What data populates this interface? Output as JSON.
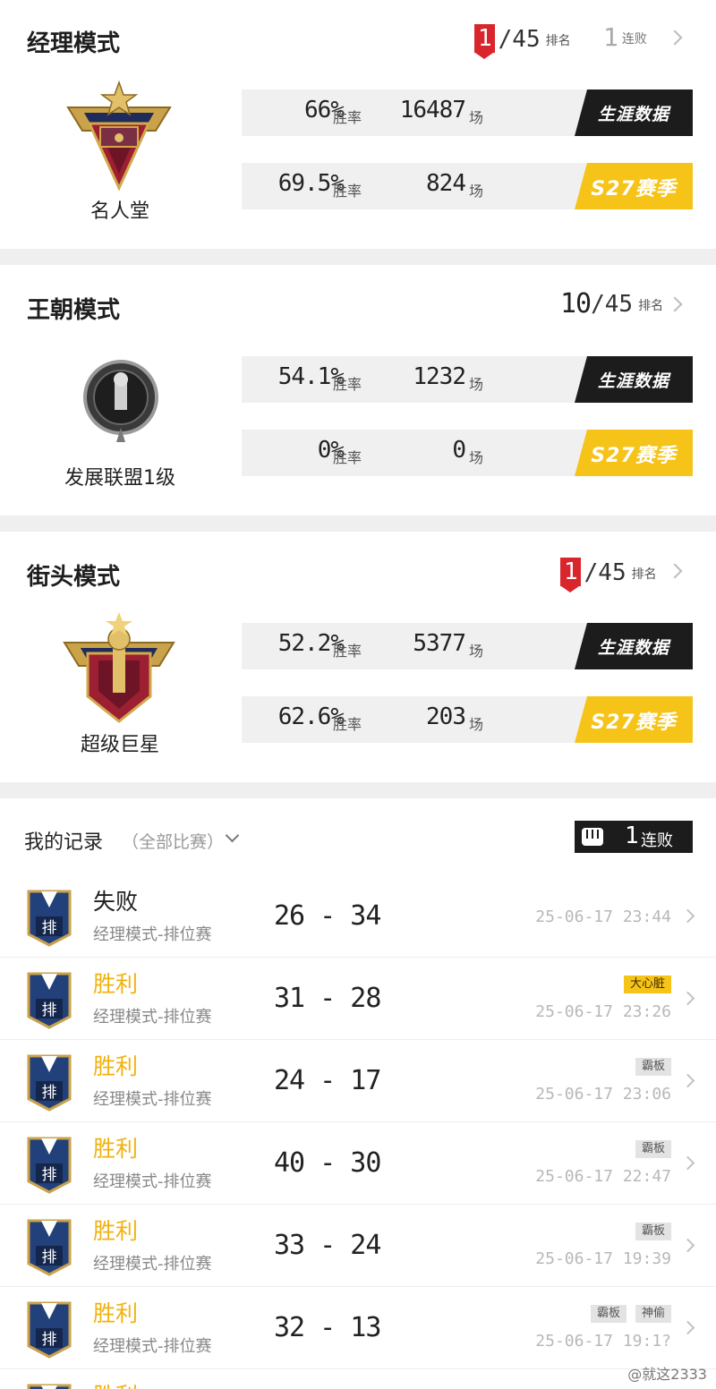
{
  "modes": [
    {
      "title": "经理模式",
      "rank": "1",
      "rank_total": "/45",
      "rank_label": "排名",
      "streak_count": "1",
      "streak_label": "连败",
      "badge_name": "名人堂",
      "badge_icon": "hall-of-fame-badge-icon",
      "career": {
        "pct": "66%",
        "pct_label": "胜率",
        "games": "16487",
        "games_label": "场",
        "btn": "生涯数据"
      },
      "season": {
        "pct": "69.5%",
        "pct_label": "胜率",
        "games": "824",
        "games_label": "场",
        "btn": "S27赛季"
      }
    },
    {
      "title": "王朝模式",
      "rank": "10",
      "rank_total": "/45",
      "rank_label": "排名",
      "badge_name": "发展联盟1级",
      "badge_icon": "development-league-badge-icon",
      "career": {
        "pct": "54.1%",
        "pct_label": "胜率",
        "games": "1232",
        "games_label": "场",
        "btn": "生涯数据"
      },
      "season": {
        "pct": "0%",
        "pct_label": "胜率",
        "games": "0",
        "games_label": "场",
        "btn": "S27赛季"
      }
    },
    {
      "title": "街头模式",
      "rank": "1",
      "rank_total": "/45",
      "rank_label": "排名",
      "badge_name": "超级巨星",
      "badge_icon": "superstar-badge-icon",
      "career": {
        "pct": "52.2%",
        "pct_label": "胜率",
        "games": "5377",
        "games_label": "场",
        "btn": "生涯数据"
      },
      "season": {
        "pct": "62.6%",
        "pct_label": "胜率",
        "games": "203",
        "games_label": "场",
        "btn": "S27赛季"
      }
    }
  ],
  "records": {
    "title": "我的记录",
    "filter": "（全部比赛）",
    "streak_count": "1",
    "streak_label": "连败",
    "matches": [
      {
        "result": "失败",
        "win": false,
        "sub": "经理模式-排位赛",
        "score": "26 - 34",
        "time": "25-06-17 23:44",
        "tags": []
      },
      {
        "result": "胜利",
        "win": true,
        "sub": "经理模式-排位赛",
        "score": "31 - 28",
        "time": "25-06-17 23:26",
        "tags": [
          {
            "label": "大心脏",
            "gold": true
          }
        ]
      },
      {
        "result": "胜利",
        "win": true,
        "sub": "经理模式-排位赛",
        "score": "24 - 17",
        "time": "25-06-17 23:06",
        "tags": [
          {
            "label": "霸板",
            "gold": false
          }
        ]
      },
      {
        "result": "胜利",
        "win": true,
        "sub": "经理模式-排位赛",
        "score": "40 - 30",
        "time": "25-06-17 22:47",
        "tags": [
          {
            "label": "霸板",
            "gold": false
          }
        ]
      },
      {
        "result": "胜利",
        "win": true,
        "sub": "经理模式-排位赛",
        "score": "33 - 24",
        "time": "25-06-17 19:39",
        "tags": [
          {
            "label": "霸板",
            "gold": false
          }
        ]
      },
      {
        "result": "胜利",
        "win": true,
        "sub": "经理模式-排位赛",
        "score": "32 - 13",
        "time": "25-06-17 19:1?",
        "tags": [
          {
            "label": "霸板",
            "gold": false
          },
          {
            "label": "神偷",
            "gold": false
          }
        ]
      },
      {
        "result": "胜利",
        "win": true,
        "sub": "",
        "score": "",
        "time": "",
        "tags": []
      }
    ],
    "match_icon_label": "排"
  },
  "watermark": "@就这2333",
  "colors": {
    "rank_red": "#d9262d",
    "season_yellow": "#f6c318",
    "win_gold": "#f0b20e",
    "career_black": "#1c1c1c"
  }
}
